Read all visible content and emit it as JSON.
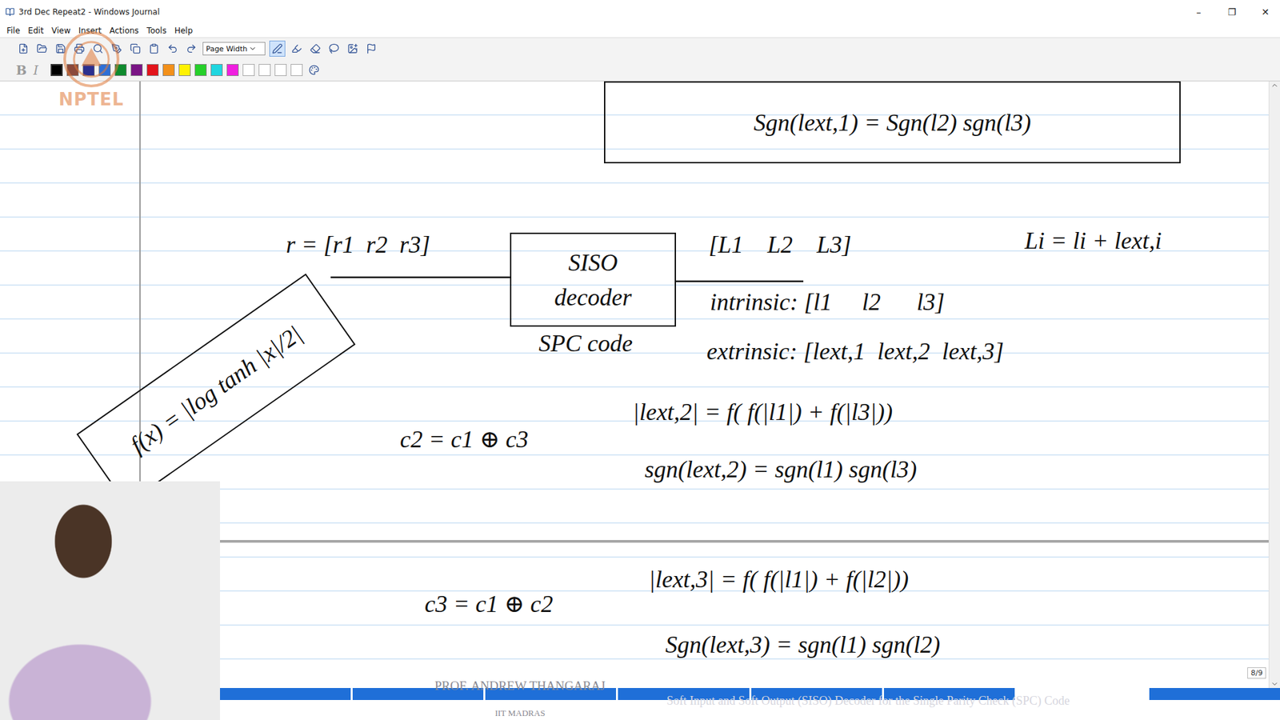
{
  "window": {
    "title": "3rd Dec Repeat2 - Windows Journal",
    "controls": [
      "–",
      "❐",
      "✕"
    ]
  },
  "menu": [
    "File",
    "Edit",
    "View",
    "Insert",
    "Actions",
    "Tools",
    "Help"
  ],
  "toolbar": {
    "zoom": "Page Width"
  },
  "format": {
    "bold": {
      "label": "B",
      "disabled": true
    },
    "italic": {
      "label": "I",
      "disabled": true
    },
    "colors": [
      {
        "color": "#000000",
        "selected": true
      },
      {
        "color": "#8b4a3c",
        "selected": false
      },
      {
        "color": "#2b2f8f",
        "selected": false
      },
      {
        "color": "#2e6fd6",
        "selected": false
      },
      {
        "color": "#0f8a2e",
        "selected": false
      },
      {
        "color": "#7a1585",
        "selected": false
      },
      {
        "color": "#e3141b",
        "selected": false
      },
      {
        "color": "#f39019",
        "selected": false
      },
      {
        "color": "#fff200",
        "selected": false
      },
      {
        "color": "#26d02a",
        "selected": false
      },
      {
        "color": "#1fd6e0",
        "selected": false
      },
      {
        "color": "#f01ee0",
        "selected": false
      }
    ]
  },
  "watermark": "NPTEL",
  "page": {
    "notes": [
      {
        "text": "Sgn(lext,1) = Sgn(l2) sgn(l3)",
        "kind": "boxed"
      },
      {
        "text": "r = [r1  r2  r3]",
        "kind": "text"
      },
      {
        "text": "SISO decoder",
        "kind": "block"
      },
      {
        "text": "SPC code",
        "kind": "text"
      },
      {
        "text": "[L1    L2    L3]",
        "kind": "text"
      },
      {
        "text": "Li = li + lext,i",
        "kind": "text"
      },
      {
        "text": "intrinsic: [l1     l2      l3]",
        "kind": "text"
      },
      {
        "text": "extrinsic: [lext,1  lext,2  lext,3]",
        "kind": "text"
      },
      {
        "text": "f(x) = |log tanh |x|/2|",
        "kind": "tilted"
      },
      {
        "text": "c2 = c1 ⊕ c3",
        "kind": "text"
      },
      {
        "text": "|lext,2| = f( f(|l1|) + f(|l3|))",
        "kind": "text"
      },
      {
        "text": "sgn(lext,2) = sgn(l1) sgn(l3)",
        "kind": "text"
      },
      {
        "text": "c3 = c1 ⊕ c2",
        "kind": "text"
      },
      {
        "text": "|lext,3| = f( f(|l1|) + f(|l2|))",
        "kind": "text"
      },
      {
        "text": "Sgn(lext,3) = sgn(l1) sgn(l2)",
        "kind": "text"
      }
    ],
    "counter": "8/9"
  },
  "video": {
    "presenter": "PROF. ANDREW THANGARAJ",
    "institute": "IIT MADRAS",
    "caption": "Soft Input and Soft Output (SISO) Decoder for the Single Parity Check (SPC) Code"
  }
}
